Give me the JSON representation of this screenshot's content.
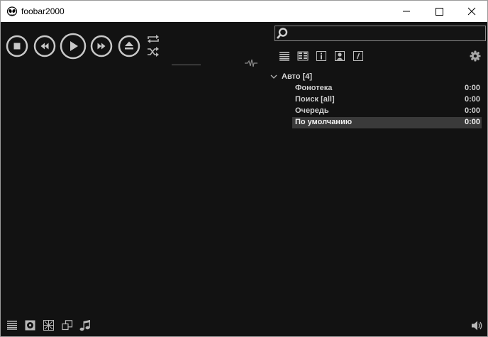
{
  "window": {
    "title": "foobar2000"
  },
  "search": {
    "value": "",
    "placeholder": ""
  },
  "transport": {
    "buttons": [
      "stop",
      "previous",
      "play",
      "next",
      "eject"
    ],
    "toggles": [
      "repeat",
      "shuffle"
    ]
  },
  "view_buttons": [
    "playlist-view",
    "columns-view",
    "info-view",
    "artist-view",
    "lyrics-view"
  ],
  "playlists": {
    "group_label": "Авто [4]",
    "items": [
      {
        "name": "Фонотека",
        "duration": "0:00"
      },
      {
        "name": "Поиск [all]",
        "duration": "0:00"
      },
      {
        "name": "Очередь",
        "duration": "0:00"
      },
      {
        "name": "По умолчанию",
        "duration": "0:00",
        "selected": true
      }
    ]
  },
  "bottom_bar": {
    "buttons": [
      "playlist-toggle",
      "album-art",
      "visualization",
      "mini-player",
      "music-note"
    ]
  },
  "colors": {
    "background": "#121212",
    "text": "#d0d0d0",
    "selected_row": "#3a3a3a",
    "icon": "#b8b8b8"
  }
}
